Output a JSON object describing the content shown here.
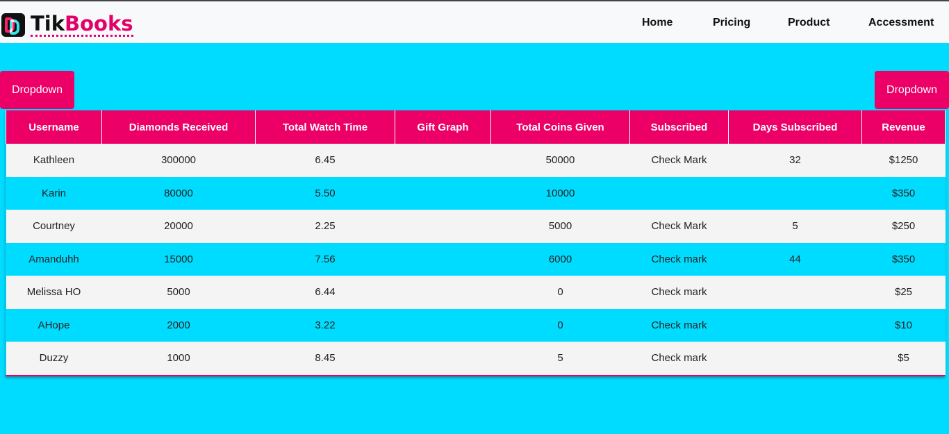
{
  "brand": {
    "tik": "Tik",
    "books": "Books"
  },
  "nav": {
    "home": "Home",
    "pricing": "Pricing",
    "product": "Product",
    "accessment": "Accessment"
  },
  "dropdowns": {
    "left": "Dropdown",
    "right": "Dropdown"
  },
  "colors": {
    "accent": "#ec0067",
    "background": "#00dcff",
    "row_light": "#f4f4f4"
  },
  "table": {
    "headers": [
      "Username",
      "Diamonds Received",
      "Total Watch Time",
      "Gift Graph",
      "Total Coins Given",
      "Subscribed",
      "Days Subscribed",
      "Revenue"
    ],
    "rows": [
      [
        "Kathleen",
        "300000",
        "6.45",
        "",
        "50000",
        "Check Mark",
        "32",
        "$1250"
      ],
      [
        "Karin",
        "80000",
        "5.50",
        "",
        "10000",
        "",
        "",
        "$350"
      ],
      [
        "Courtney",
        "20000",
        "2.25",
        "",
        "5000",
        "Check Mark",
        "5",
        "$250"
      ],
      [
        "Amanduhh",
        "15000",
        "7.56",
        "",
        "6000",
        "Check mark",
        "44",
        "$350"
      ],
      [
        "Melissa HO",
        "5000",
        "6.44",
        "",
        "0",
        "Check mark",
        "",
        "$25"
      ],
      [
        "AHope",
        "2000",
        "3.22",
        "",
        "0",
        "Check mark",
        "",
        "$10"
      ],
      [
        "Duzzy",
        "1000",
        "8.45",
        "",
        "5",
        "Check mark",
        "",
        "$5"
      ]
    ]
  }
}
